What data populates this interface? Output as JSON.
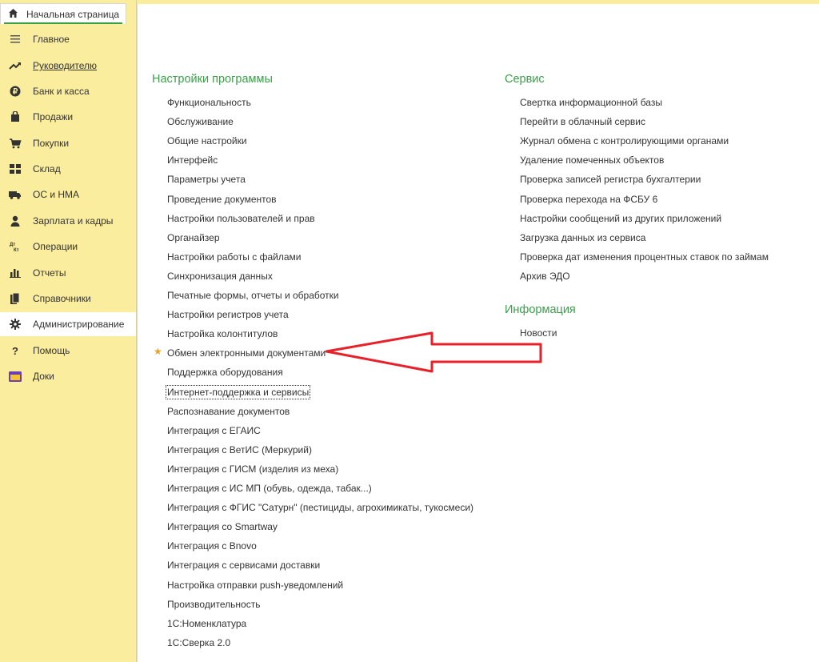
{
  "sidebar": {
    "home_tab": {
      "label": "Начальная страница",
      "icon": "home-icon"
    },
    "items": [
      {
        "label": "Главное",
        "icon": "menu-lines-icon"
      },
      {
        "label": "Руководителю",
        "icon": "trend-up-icon"
      },
      {
        "label": "Банк и касса",
        "icon": "ruble-icon"
      },
      {
        "label": "Продажи",
        "icon": "bag-icon"
      },
      {
        "label": "Покупки",
        "icon": "cart-icon"
      },
      {
        "label": "Склад",
        "icon": "warehouse-grid-icon"
      },
      {
        "label": "ОС и НМА",
        "icon": "truck-icon"
      },
      {
        "label": "Зарплата и кадры",
        "icon": "person-icon"
      },
      {
        "label": "Операции",
        "icon": "debit-credit-icon",
        "icon_text": "Дт Кт"
      },
      {
        "label": "Отчеты",
        "icon": "bar-chart-icon"
      },
      {
        "label": "Справочники",
        "icon": "books-icon"
      },
      {
        "label": "Администрирование",
        "icon": "gear-icon"
      },
      {
        "label": "Помощь",
        "icon": "question-icon",
        "icon_text": "?"
      },
      {
        "label": "Доки",
        "icon": "folder-icon"
      }
    ]
  },
  "main": {
    "settings": {
      "title": "Настройки программы",
      "links": [
        "Функциональность",
        "Обслуживание",
        "Общие настройки",
        "Интерфейс",
        "Параметры учета",
        "Проведение документов",
        "Настройки пользователей и прав",
        "Органайзер",
        "Настройки работы с файлами",
        "Синхронизация данных",
        "Печатные формы, отчеты и обработки",
        "Настройки регистров учета",
        "Настройка колонтитулов",
        "Обмен электронными документами",
        "Поддержка оборудования",
        "Интернет-поддержка и сервисы",
        "Распознавание документов",
        "Интеграция с ЕГАИС",
        "Интеграция с ВетИС (Меркурий)",
        "Интеграция с ГИСМ (изделия из меха)",
        "Интеграция с ИС МП (обувь, одежда, табак...)",
        "Интеграция с ФГИС \"Сатурн\" (пестициды, агрохимикаты, тукосмеси)",
        "Интеграция со Smartway",
        "Интеграция с Bnovo",
        "Интеграция с сервисами доставки",
        "Настройка отправки push-уведомлений",
        "Производительность",
        "1С:Номенклатура",
        "1С:Сверка 2.0"
      ]
    },
    "service": {
      "title": "Сервис",
      "links": [
        "Свертка информационной базы",
        "Перейти в облачный сервис",
        "Журнал обмена с контролирующими органами",
        "Удаление помеченных объектов",
        "Проверка записей регистра бухгалтерии",
        "Проверка перехода на ФСБУ 6",
        "Настройки сообщений из других приложений",
        "Загрузка данных из сервиса",
        "Проверка дат изменения процентных ставок по займам",
        "Архив ЭДО"
      ]
    },
    "info": {
      "title": "Информация",
      "links": [
        "Новости"
      ]
    },
    "favorite_icon": "star-icon",
    "annotation": {
      "icon": "red-arrow-icon",
      "color": "#e8202a"
    }
  }
}
